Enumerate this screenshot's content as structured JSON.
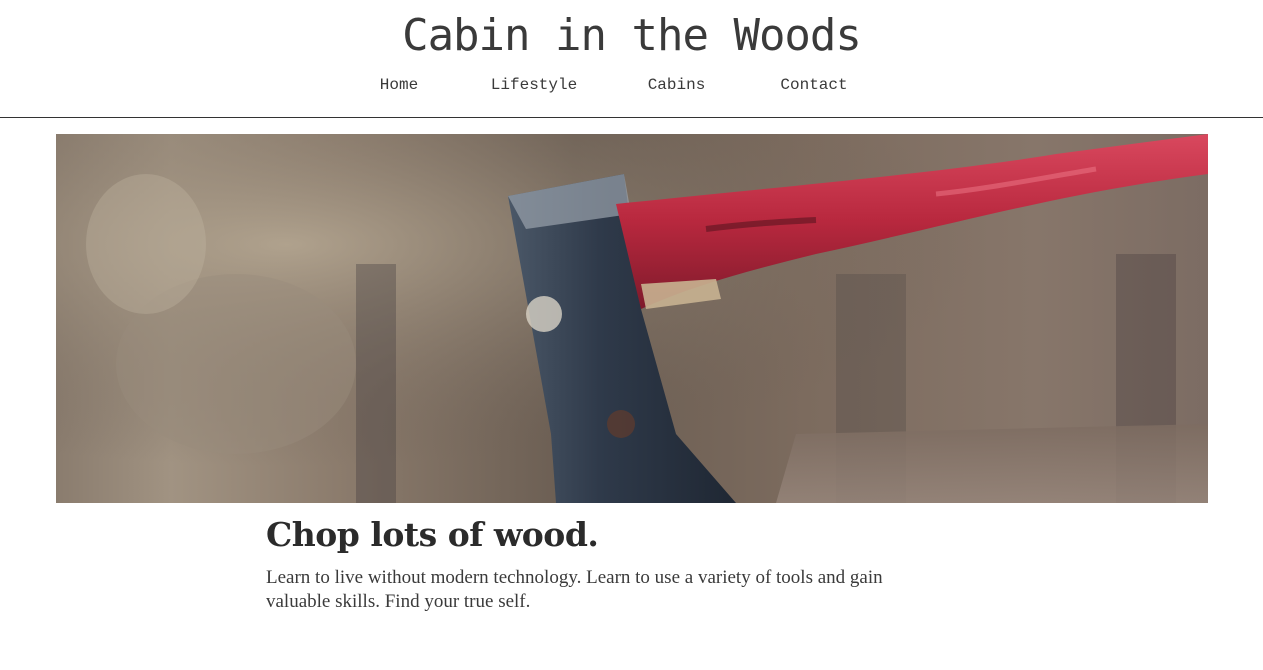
{
  "header": {
    "site_title": "Cabin in the Woods",
    "nav": [
      {
        "label": "Home"
      },
      {
        "label": "Lifestyle"
      },
      {
        "label": "Cabins"
      },
      {
        "label": "Contact"
      }
    ]
  },
  "hero": {
    "image": "axe-with-red-handle-photo"
  },
  "main": {
    "headline": "Chop lots of wood.",
    "body": "Learn to live without modern technology. Learn to use a variety of tools and gain valuable skills. Find your true self."
  },
  "colors": {
    "text": "#2b2b2b",
    "background": "#ffffff",
    "divider": "#333333",
    "axe_handle": "#b8283e",
    "axe_head": "#2f3a4a"
  }
}
